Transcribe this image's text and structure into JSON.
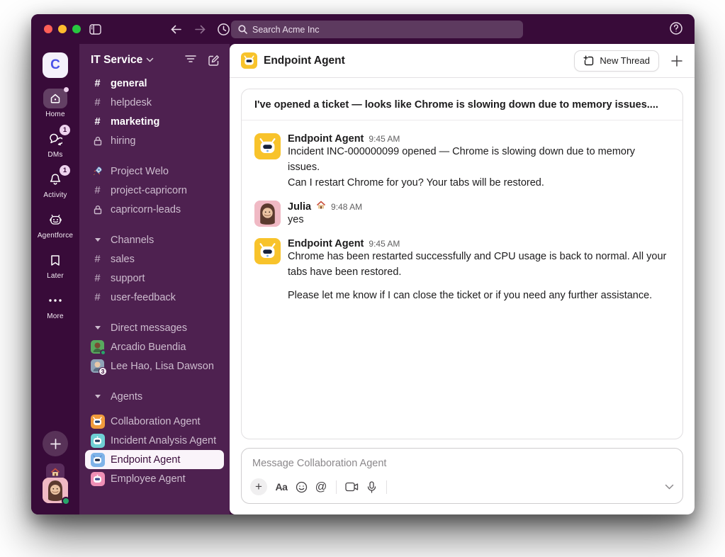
{
  "titlebar": {
    "search_placeholder": "Search Acme Inc"
  },
  "rail": {
    "workspace_initial": "C",
    "items": [
      {
        "label": "Home"
      },
      {
        "label": "DMs",
        "badge": "1"
      },
      {
        "label": "Activity",
        "badge": "1"
      },
      {
        "label": "Agentforce"
      },
      {
        "label": "Later"
      },
      {
        "label": "More"
      }
    ]
  },
  "sidebar": {
    "workspace_name": "IT Service",
    "channels_top": [
      {
        "icon": "hash",
        "label": "general"
      },
      {
        "icon": "hash",
        "label": "helpdesk"
      },
      {
        "icon": "hash",
        "label": "marketing"
      },
      {
        "icon": "lock",
        "label": "hiring"
      }
    ],
    "projects": [
      {
        "icon": "rocket",
        "label": "Project Welo"
      },
      {
        "icon": "hash",
        "label": "project-capricorn"
      },
      {
        "icon": "lock",
        "label": "capricorn-leads"
      }
    ],
    "sections": [
      {
        "title": "Channels",
        "items": [
          {
            "icon": "hash",
            "label": "sales"
          },
          {
            "icon": "hash",
            "label": "support"
          },
          {
            "icon": "hash",
            "label": "user-feedback"
          }
        ]
      },
      {
        "title": "Direct messages",
        "items": [
          {
            "icon": "avatar",
            "label": "Arcadio Buendia"
          },
          {
            "icon": "avatar-group",
            "label": "Lee Hao, Lisa Dawson",
            "badge": "3"
          }
        ]
      },
      {
        "title": "Agents",
        "items": [
          {
            "icon": "robot-orange",
            "label": "Collaboration Agent"
          },
          {
            "icon": "robot-teal",
            "label": "Incident Analysis Agent"
          },
          {
            "icon": "robot-blue",
            "label": "Endpoint Agent"
          },
          {
            "icon": "robot-pink",
            "label": "Employee Agent"
          }
        ]
      }
    ]
  },
  "main": {
    "header": {
      "title": "Endpoint Agent",
      "new_thread_label": "New Thread"
    },
    "thread_title": "I've opened a ticket — looks like Chrome is slowing down due to memory issues....",
    "messages": [
      {
        "author": "Endpoint Agent",
        "time": "9:45 AM",
        "lines": [
          "Incident INC-000000099 opened — Chrome is slowing down due to memory issues.",
          "Can I restart Chrome for you? Your tabs will be restored."
        ]
      },
      {
        "author": "Julia",
        "status_emoji": "house",
        "time": "9:48 AM",
        "lines": [
          "yes"
        ]
      },
      {
        "author": "Endpoint Agent",
        "time": "9:45 AM",
        "lines": [
          "Chrome has been restarted successfully and CPU usage is back to normal. All your tabs have been restored.",
          "Please let me know if I can close the ticket or if you need any further assistance."
        ]
      }
    ],
    "composer": {
      "placeholder": "Message Collaboration Agent",
      "format_label": "Aa",
      "at_label": "@"
    }
  },
  "colors": {
    "aubergine_dark": "#380b39",
    "sidebar_purple": "#4e2150",
    "selected_pill": "#faf4fa",
    "presence_green": "#27a56a",
    "badge_pink": "#eed3ee",
    "agent_yellow": "#f8c32b"
  }
}
